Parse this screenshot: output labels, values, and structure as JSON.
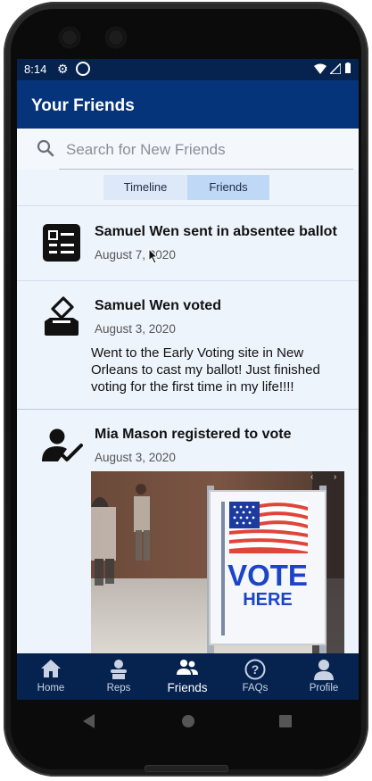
{
  "status": {
    "time": "8:14"
  },
  "appbar": {
    "title": "Your Friends"
  },
  "search": {
    "placeholder": "Search for New Friends"
  },
  "tabs": [
    {
      "label": "Timeline"
    },
    {
      "label": "Friends"
    }
  ],
  "feed": [
    {
      "title": "Samuel Wen sent in absentee ballot",
      "date": "August 7, 2020",
      "icon": "ballot-form-icon"
    },
    {
      "title": "Samuel Wen voted",
      "date": "August 3, 2020",
      "icon": "vote-box-icon",
      "body": "Went to the Early Voting site in New Orleans to cast my ballot! Just finished voting for the first time in my life!!!!"
    },
    {
      "title": "Mia Mason registered to vote",
      "date": "August 3, 2020",
      "icon": "user-check-icon",
      "image_sign": {
        "line1": "VOTE",
        "line2": "HERE"
      }
    }
  ],
  "nav": [
    {
      "label": "Home",
      "icon": "home-icon"
    },
    {
      "label": "Reps",
      "icon": "reps-icon"
    },
    {
      "label": "Friends",
      "icon": "friends-icon",
      "active": true
    },
    {
      "label": "FAQs",
      "icon": "question-icon"
    },
    {
      "label": "Profile",
      "icon": "profile-icon"
    }
  ],
  "colors": {
    "statusbar": "#06234f",
    "appbar": "#06347a",
    "background": "#eef4fc",
    "navbar": "#06234f",
    "tab_active": "#bfd8f6"
  }
}
